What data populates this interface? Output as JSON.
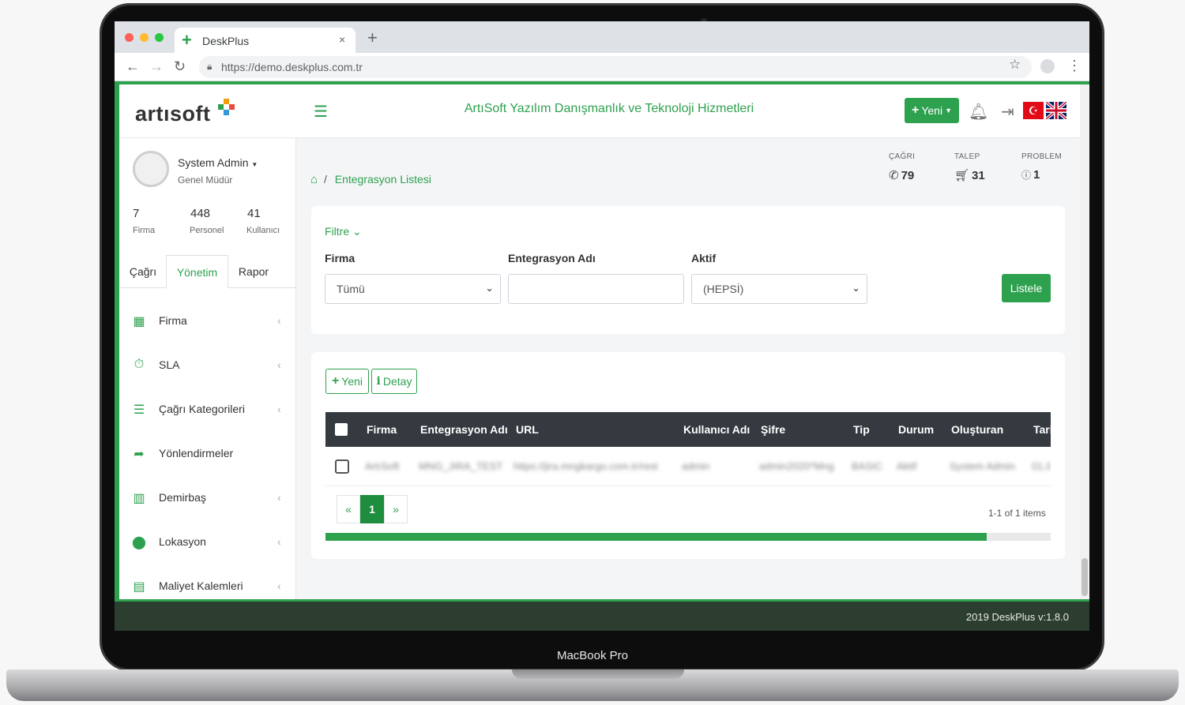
{
  "device": {
    "label": "MacBook Pro"
  },
  "browser": {
    "tab_title": "DeskPlus",
    "tab_close": "×",
    "new_tab": "+",
    "url": "https://demo.deskplus.com.tr",
    "traffic_lights": [
      "#ff5f57",
      "#febc2e",
      "#28c840"
    ]
  },
  "header": {
    "logo": "artısoft",
    "menu_icon": "hamburger-icon",
    "company_title": "ArtıSoft Yazılım Danışmanlık ve Teknoloji Hizmetleri",
    "new_button": "Yeni",
    "accent": "#2ea14f"
  },
  "user": {
    "name": "System Admin",
    "role": "Genel Müdür",
    "stats": [
      {
        "value": "7",
        "label": "Firma"
      },
      {
        "value": "448",
        "label": "Personel"
      },
      {
        "value": "41",
        "label": "Kullanıcı"
      }
    ]
  },
  "sidebar": {
    "tabs": [
      {
        "label": "Çağrı"
      },
      {
        "label": "Yönetim"
      },
      {
        "label": "Rapor"
      }
    ],
    "items": [
      {
        "label": "Firma",
        "icon": "building-icon",
        "has_submenu": true
      },
      {
        "label": "SLA",
        "icon": "stopwatch-icon",
        "has_submenu": true
      },
      {
        "label": "Çağrı Kategorileri",
        "icon": "list-icon",
        "has_submenu": true
      },
      {
        "label": "Yönlendirmeler",
        "icon": "share-arrow-icon",
        "has_submenu": false
      },
      {
        "label": "Demirbaş",
        "icon": "barcode-icon",
        "has_submenu": true
      },
      {
        "label": "Lokasyon",
        "icon": "map-pin-icon",
        "has_submenu": true
      },
      {
        "label": "Maliyet Kalemleri",
        "icon": "money-icon",
        "has_submenu": true
      }
    ]
  },
  "breadcrumb": {
    "separator": "/",
    "current": "Entegrasyon Listesi"
  },
  "kpis": [
    {
      "label": "ÇAĞRI",
      "value": "79",
      "icon": "phone-icon"
    },
    {
      "label": "TALEP",
      "value": "31",
      "icon": "cart-icon"
    },
    {
      "label": "PROBLEM",
      "value": "1",
      "icon": "question-icon"
    }
  ],
  "filter": {
    "toggle_label": "Filtre",
    "firma_label": "Firma",
    "firma_value": "Tümü",
    "entegrasyon_label": "Entegrasyon Adı",
    "entegrasyon_value": "",
    "aktif_label": "Aktif",
    "aktif_value": "(HEPSİ)",
    "list_button": "Listele"
  },
  "grid": {
    "new_button": "Yeni",
    "detail_button": "Detay",
    "columns": [
      "Firma",
      "Entegrasyon Adı",
      "URL",
      "Kullanıcı Adı",
      "Şifre",
      "Tip",
      "Durum",
      "Oluşturan",
      "Tari"
    ],
    "rows": [
      [
        "ArtıSoft",
        "MNG_JIRA_TEST",
        "https://jira.mngkargo.com.tr/rest",
        "admin",
        "admin2020*Mng",
        "BASIC",
        "Aktif",
        "System Admin",
        "01.0"
      ]
    ],
    "pager": {
      "prev": "«",
      "page": "1",
      "next": "»"
    },
    "items_info": "1-1 of 1 items",
    "scroll_fraction": 0.912
  },
  "footer": {
    "text": "2019 DeskPlus v:1.8.0"
  }
}
